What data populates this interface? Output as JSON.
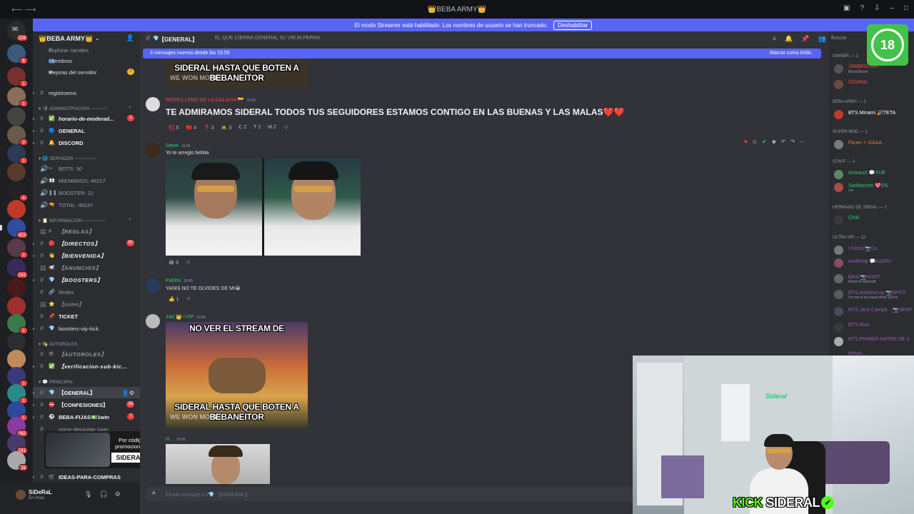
{
  "window": {
    "title": "👑BEBA ARMY👑"
  },
  "banner": {
    "text": "El modo Streamer está habilitado. Los nombres de usuario se han truncado.",
    "button": "Deshabilitar"
  },
  "server": {
    "name": "👑BEBA ARMY👑"
  },
  "sidebar": {
    "top": [
      "Explorar canales",
      "Miembros",
      "Mejoras del servidor"
    ],
    "channels": [
      {
        "name": "registroems"
      },
      {
        "cat": "ADMINISTRACION ~~~~~~"
      },
      {
        "name": "horario-de-moderad..."
      },
      {
        "name": "GENERAL"
      },
      {
        "name": "DISCORD"
      },
      {
        "cat": "SERVIDOR ~~~~~~~~"
      },
      {
        "name": "BOTS: 30"
      },
      {
        "name": "MIEMBROS: 46217"
      },
      {
        "name": "BOOSTER: 21"
      },
      {
        "name": "TOTAL: 46247"
      },
      {
        "cat": "INFORMACION ~~~~~~~~"
      },
      {
        "name": "【REGLAS】"
      },
      {
        "name": "【DIRECTOS】"
      },
      {
        "name": "【BIENVENIDA】"
      },
      {
        "name": "【ANUNCIOS】"
      },
      {
        "name": "【BOOSTERS】"
      },
      {
        "name": "Redes"
      },
      {
        "name": "【sorteo】"
      },
      {
        "name": "TICKET"
      },
      {
        "name": "boosters-vip-kick"
      },
      {
        "cat": "AUTOROLES"
      },
      {
        "name": "【AUTOROLES】"
      },
      {
        "name": "【verificacion-sub-kic..."
      },
      {
        "cat": "PRINCIPAL"
      },
      {
        "name": "【GENERAL】"
      },
      {
        "name": "【CONFESIONES】"
      },
      {
        "name": "BEBA-FIJAS💵1win"
      },
      {
        "name": "como-depositar-1win"
      },
      {
        "name": "IDEAS-PARA-COMPRAS"
      }
    ],
    "counts": {
      "mejoras": "!",
      "horario": "1",
      "directos": "92",
      "confesiones": "26",
      "fijas": "7"
    }
  },
  "promo": {
    "line1": "Por código",
    "line2": "promocional",
    "code": "SIDERAL"
  },
  "user": {
    "name": "SiDeRaL",
    "status": "En línea"
  },
  "header": {
    "channel": "【GENERAL】",
    "topic": "EL QUE CIERRA GENERAL SU VIEJA PERRA"
  },
  "newbar": {
    "left": "3 mensajes nuevos desde las 15:55",
    "right": "Marcar como leído"
  },
  "messages": [
    {
      "meme_bottom": "SIDERAL HASTA QUE BOTEN A BEBANEITOR",
      "wm": "WE WON MORE!"
    },
    {
      "author": "PATRULLERO DE LA GALAXIA 🇨🇴",
      "time": "16:05",
      "text": "TE ADMIRAMOS SIDERAL TODOS TUS SEGUIDORES ESTAMOS CONTIGO EN LAS BUENAS Y LAS MALAS❤️❤️",
      "reacts": [
        "🚫 5",
        "🇨🇳 4",
        "❓ 3",
        "🤼 3",
        "C 2",
        "T 2",
        "M 2",
        "☺"
      ]
    },
    {
      "author": "Steve",
      "time": "16:05",
      "text": "Yo te arreglo bebita",
      "reacts": [
        "😂 9",
        "☺"
      ]
    },
    {
      "author": "Pablito",
      "time": "16:05",
      "text": "YANIS NO TE OLVIDES DE MI😭",
      "reacts": [
        "👍 1",
        "☺"
      ]
    },
    {
      "author": "J4И 👑⚡VIP",
      "time": "16:05",
      "meme_top": "NO VER EL STREAM DE",
      "meme_bottom": "SIDERAL HASTA QUE BOTEN A BEBANEITOR",
      "wm": "WE WON MORE!"
    },
    {
      "author": "H...",
      "time": "16:05"
    }
  ],
  "input": {
    "placeholder": "Enviar mensaje a #💎 【GENERAL】"
  },
  "members": {
    "search": "Buscar",
    "groups": [
      {
        "cat": "OWNER — 2"
      },
      {
        "name": "JAMBRICAM...",
        "sub": "Mood Bored",
        "color": "#e74c3c"
      },
      {
        "name": "SiDeRaL",
        "sub": "",
        "color": "#e74c3c"
      },
      {
        "cat": "BEBA ARMY — 1"
      },
      {
        "name": "BTS.Minami 🎉TETA",
        "sub": "",
        "color": "#ffffff"
      },
      {
        "cat": "SUPER MOD — 1"
      },
      {
        "name": "Flicen ⚡ GAAA",
        "sub": "",
        "color": "#e67e22"
      },
      {
        "cat": "STAFF — 2"
      },
      {
        "name": "AronasX 💬YUE",
        "sub": "",
        "color": "#2ecc71"
      },
      {
        "name": "Saddaccee 💖DS",
        "sub": "Lol",
        "color": "#2ecc71"
      },
      {
        "cat": "hermano de sibsal — 1"
      },
      {
        "name": "Chiki",
        "sub": "",
        "color": "#2ecc71"
      },
      {
        "cat": "ULTRA VIP — 12"
      },
      {
        "name": "I Isisss 📷Cx",
        "sub": "",
        "color": "#9b59b6"
      },
      {
        "name": "Andhsnp 💬KIORU",
        "sub": "",
        "color": "#9b59b6"
      },
      {
        "name": "blind 📷HUNT",
        "sub": "World of Warcraft",
        "color": "#9b59b6"
      },
      {
        "name": "BTS.andreee.oy 📷SPDY",
        "sub": "I'm out of my head when you're",
        "color": "#9b59b6"
      },
      {
        "name": "BTS.Jack Campb... 📷SEAF",
        "sub": "",
        "color": "#9b59b6"
      },
      {
        "name": "BTS.Miss",
        "sub": "",
        "color": "#9b59b6"
      },
      {
        "name": "BTS.PRIMER HATER DE S",
        "sub": "",
        "color": "#9b59b6"
      },
      {
        "name": "Kelvin...",
        "sub": "",
        "color": "#9b59b6"
      }
    ]
  },
  "age_badge": "18",
  "stream": {
    "brand": "KICK",
    "name": "SIDERAL",
    "tag": "Sideral"
  },
  "colors": {
    "accent": "#5865f2",
    "kick": "#53fc18"
  }
}
